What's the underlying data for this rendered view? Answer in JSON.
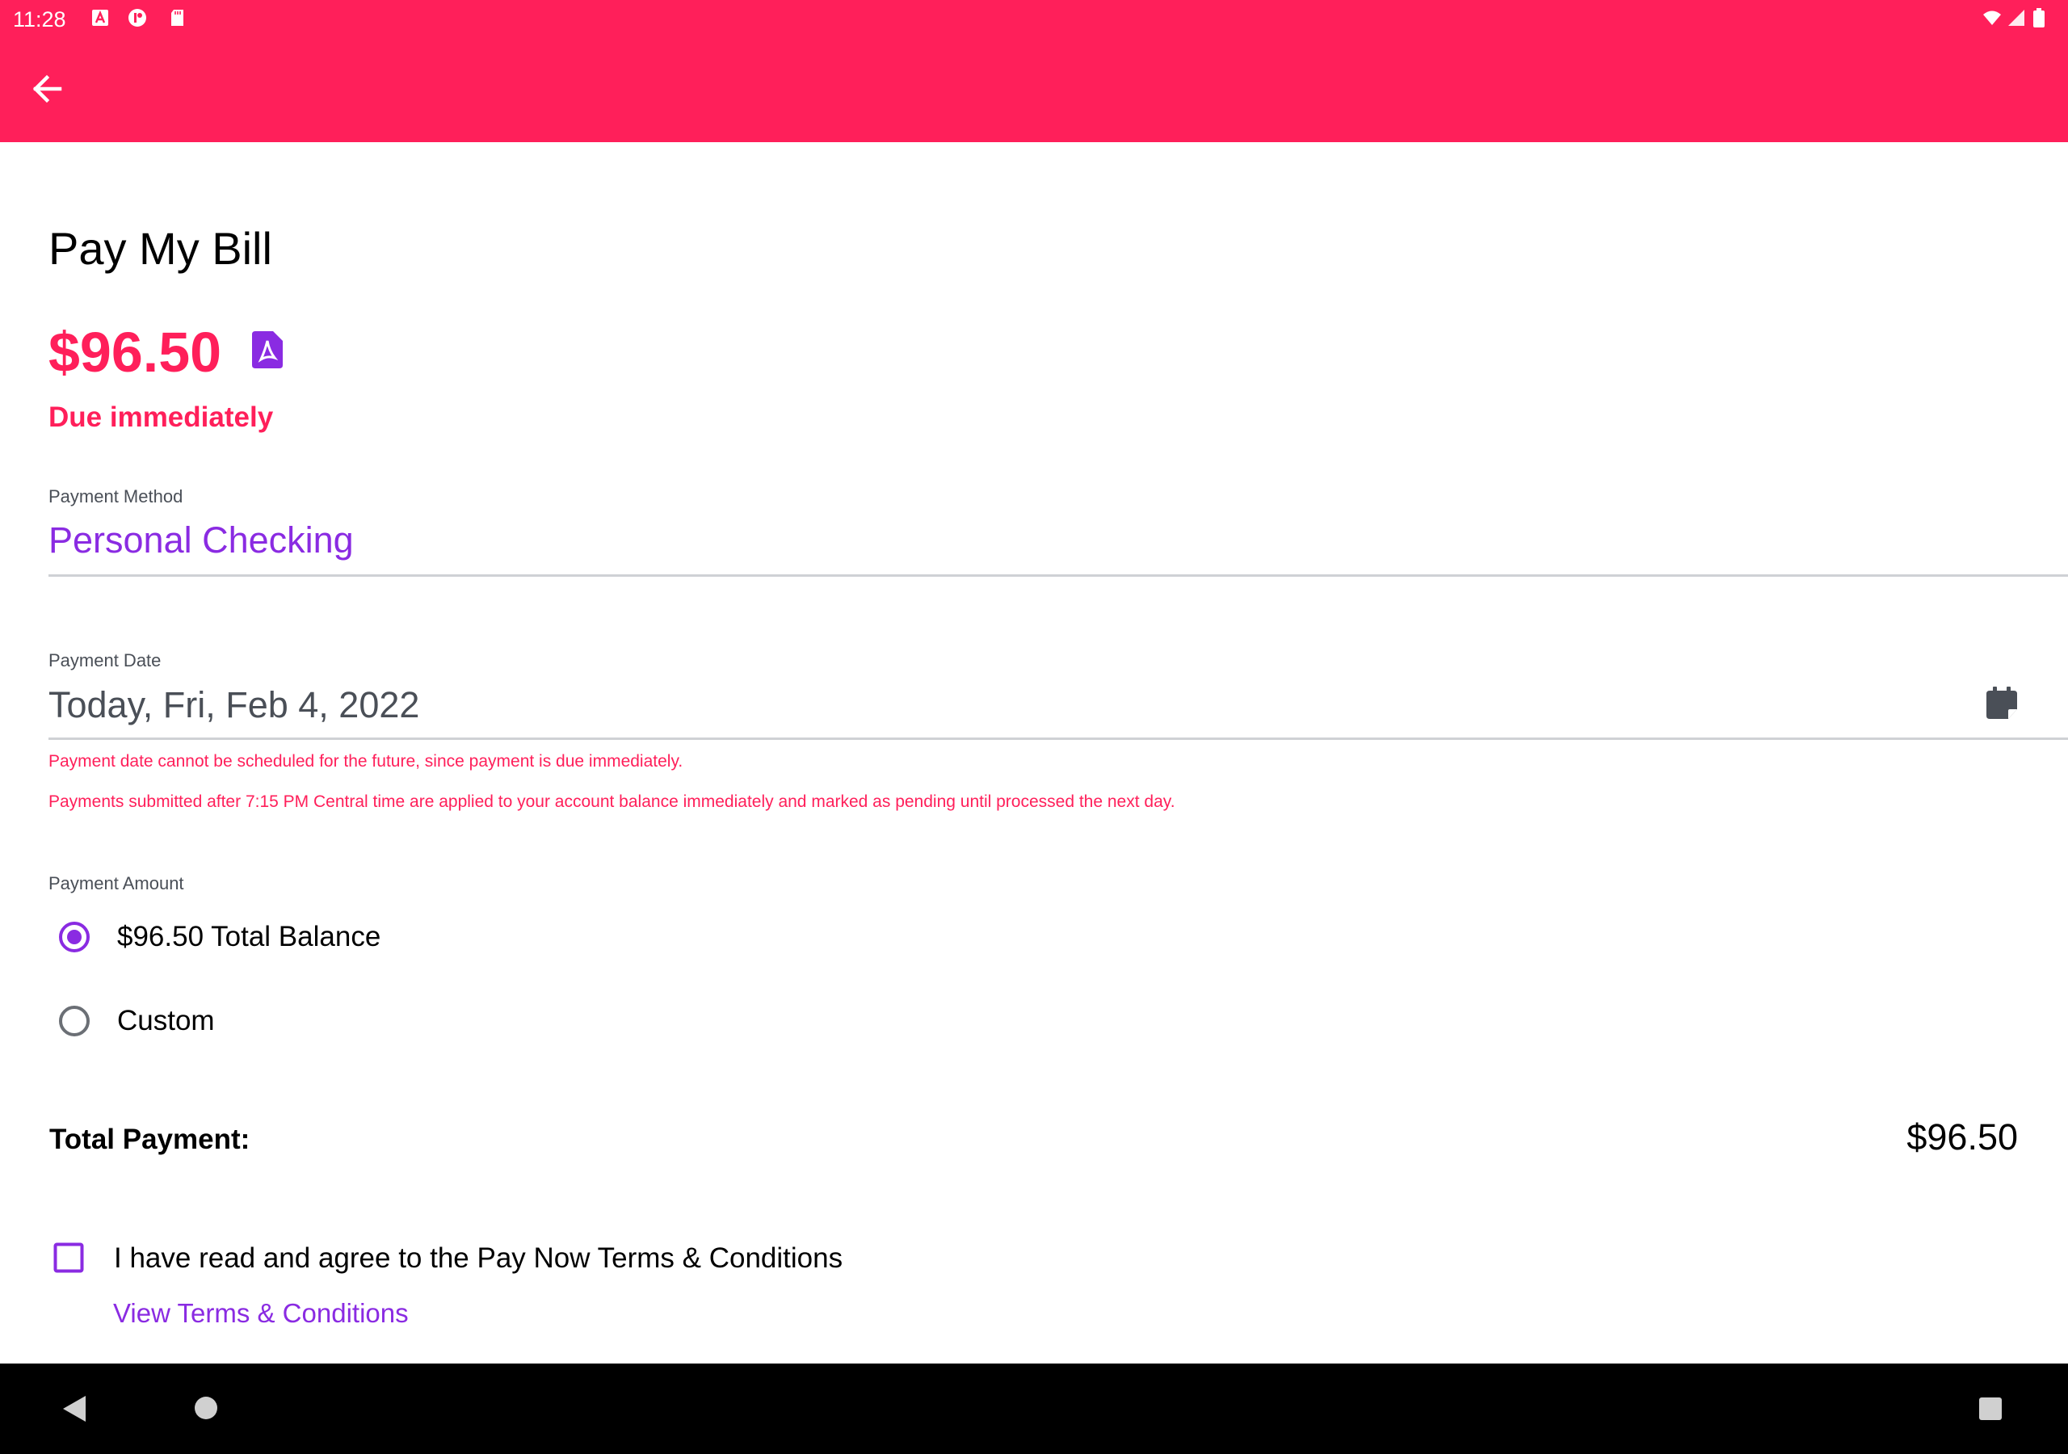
{
  "status_bar": {
    "time": "11:28"
  },
  "icons": {
    "back": "arrow-left-icon",
    "pdf": "pdf-document-icon",
    "calendar": "calendar-icon",
    "wifi": "wifi-icon",
    "signal": "signal-icon",
    "battery": "battery-icon"
  },
  "colors": {
    "header": "#ff1f5a",
    "accent": "#8a2be2",
    "alert": "#ff1f5a"
  },
  "page": {
    "title": "Pay My Bill",
    "amount": "$96.50",
    "due_status": "Due immediately"
  },
  "payment_method": {
    "label": "Payment Method",
    "value": "Personal Checking"
  },
  "payment_date": {
    "label": "Payment Date",
    "value": "Today, Fri, Feb 4, 2022",
    "warning": "Payment date cannot be scheduled for the future, since payment is due immediately.",
    "note": "Payments submitted after 7:15 PM Central time are applied to your account balance immediately and marked as pending until processed the next day."
  },
  "payment_amount": {
    "label": "Payment Amount",
    "options": [
      {
        "label": "$96.50 Total Balance",
        "selected": true
      },
      {
        "label": "Custom",
        "selected": false
      }
    ]
  },
  "total": {
    "label": "Total Payment:",
    "value": "$96.50"
  },
  "terms": {
    "label": "I have read and agree to the Pay Now Terms & Conditions",
    "checked": false,
    "link": "View Terms & Conditions"
  }
}
